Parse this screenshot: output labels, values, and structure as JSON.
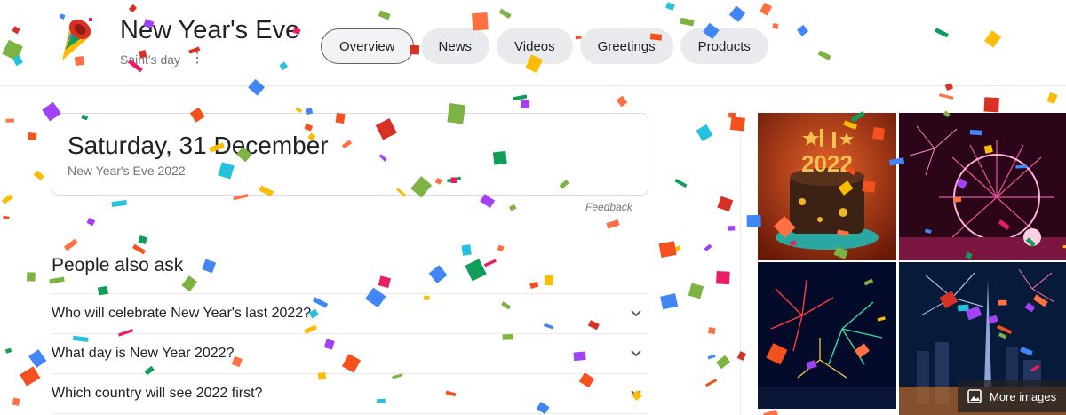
{
  "header": {
    "title": "New Year's Eve",
    "subtitle": "Saint's day",
    "more_icon": "⋮",
    "tabs": [
      {
        "label": "Overview",
        "selected": true
      },
      {
        "label": "News",
        "selected": false
      },
      {
        "label": "Videos",
        "selected": false
      },
      {
        "label": "Greetings",
        "selected": false
      },
      {
        "label": "Products",
        "selected": false
      }
    ]
  },
  "date_card": {
    "date": "Saturday, 31 December",
    "caption": "New Year's Eve 2022"
  },
  "feedback_label": "Feedback",
  "people_also_ask": {
    "title": "People also ask",
    "questions": [
      "Who will celebrate New Year's last 2022?",
      "What day is New Year 2022?",
      "Which country will see 2022 first?"
    ]
  },
  "images": {
    "cake_text": "2022",
    "more_label": "More images"
  },
  "colors": {
    "confetti": [
      "#e91e63",
      "#f4511e",
      "#fbbc05",
      "#0f9d58",
      "#4285f4",
      "#a142f4",
      "#24c1e0",
      "#d93025",
      "#ff7043",
      "#7cb342"
    ]
  }
}
